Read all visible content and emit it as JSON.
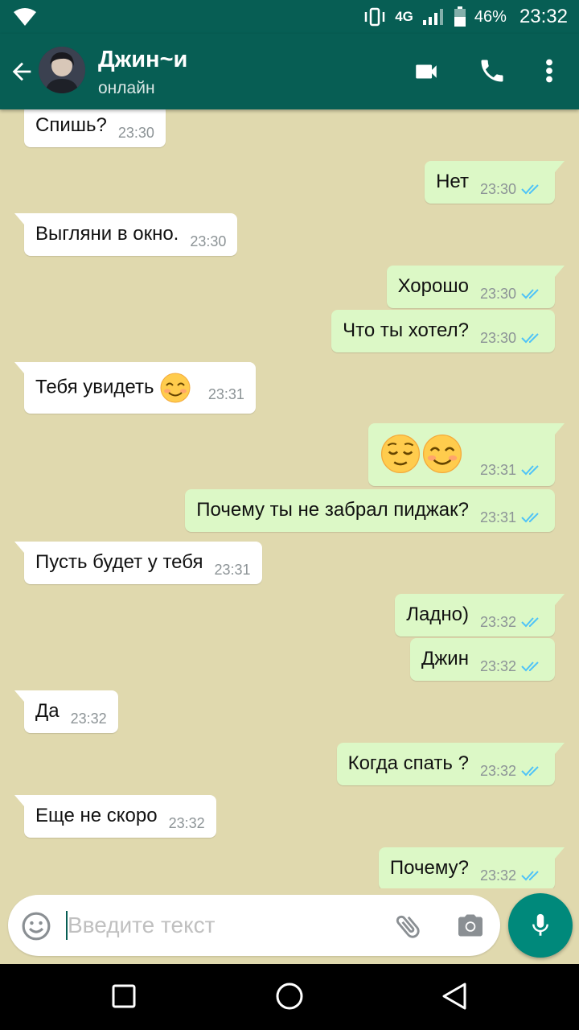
{
  "status_bar": {
    "network": "4G",
    "battery": "46%",
    "time": "23:32"
  },
  "header": {
    "contact_name": "Джин~и",
    "status": "онлайн",
    "icons": [
      "back-arrow-icon",
      "video-call-icon",
      "phone-icon",
      "more-vert-icon"
    ]
  },
  "messages": [
    {
      "dir": "in",
      "text": "Спишь?",
      "time": "23:30"
    },
    {
      "dir": "out",
      "text": "Нет",
      "time": "23:30",
      "read": true
    },
    {
      "dir": "in",
      "text": "Выгляни в окно.",
      "time": "23:30"
    },
    {
      "dir": "out",
      "text": "Хорошо",
      "time": "23:30",
      "read": true
    },
    {
      "dir": "out",
      "text": "Что ты хотел?",
      "time": "23:30",
      "read": true
    },
    {
      "dir": "in",
      "text": "Тебя увидеть",
      "emoji": "smiling-face-with-smiling-eyes",
      "time": "23:31"
    },
    {
      "dir": "out",
      "text": "",
      "emoji": [
        "relieved-face",
        "smiling-face-with-smiling-eyes"
      ],
      "time": "23:31",
      "read": true
    },
    {
      "dir": "out",
      "text": "Почему ты не забрал пиджак?",
      "time": "23:31",
      "read": true
    },
    {
      "dir": "in",
      "text": "Пусть будет у тебя",
      "time": "23:31"
    },
    {
      "dir": "out",
      "text": "Ладно)",
      "time": "23:32",
      "read": true
    },
    {
      "dir": "out",
      "text": "Джин",
      "time": "23:32",
      "read": true
    },
    {
      "dir": "in",
      "text": "Да",
      "time": "23:32"
    },
    {
      "dir": "out",
      "text": "Когда спать ?",
      "time": "23:32",
      "read": true
    },
    {
      "dir": "in",
      "text": "Еще не скоро",
      "time": "23:32"
    },
    {
      "dir": "out",
      "text": "Почему?",
      "time": "23:32",
      "read": true
    }
  ],
  "input": {
    "placeholder": "Введите текст"
  },
  "colors": {
    "header": "#075e54",
    "chat_background": "#e0d9ae",
    "outgoing_bubble": "#dcf8c6",
    "incoming_bubble": "#ffffff",
    "read_ticks": "#4fc3f7",
    "mic_button": "#00897b"
  }
}
